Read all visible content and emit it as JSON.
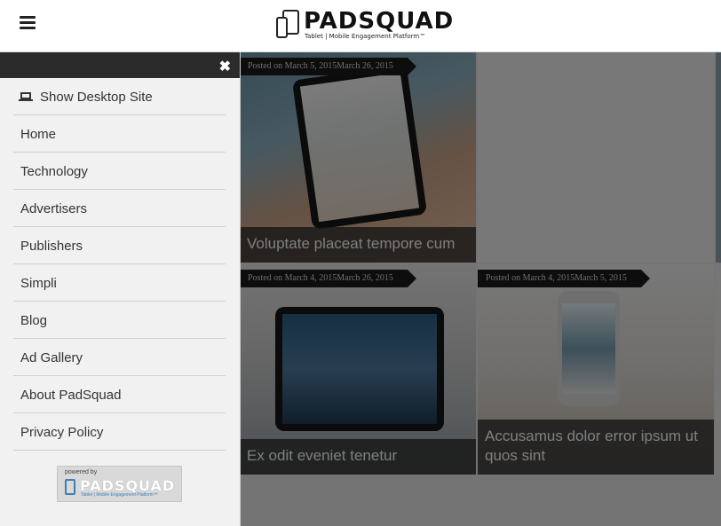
{
  "header": {
    "logo_word": "PADSQUAD",
    "logo_tagline": "Tablet | Mobile Engagement Platform™"
  },
  "sidebar": {
    "close_icon": "close-icon",
    "items": [
      {
        "label": "Show Desktop Site",
        "icon": "laptop-icon"
      },
      {
        "label": "Home"
      },
      {
        "label": "Technology"
      },
      {
        "label": "Advertisers"
      },
      {
        "label": "Publishers"
      },
      {
        "label": "Simpli"
      },
      {
        "label": "Blog"
      },
      {
        "label": "Ad Gallery"
      },
      {
        "label": "About PadSquad"
      },
      {
        "label": "Privacy Policy"
      }
    ],
    "powered": {
      "small": "powered by",
      "word": "PADSQUAD",
      "tagline": "Tablet | Mobile Engagement Platform™"
    }
  },
  "posts": [
    {
      "posted": "Posted on March 5, 2015March 26, 2015",
      "title": "Voluptate placeat tempore cum"
    },
    {
      "posted": "Posted on March 4, 2015March 26, 2015",
      "title": "Ex odit eveniet tenetur"
    },
    {
      "posted": "Posted on March 4, 2015March 5, 2015",
      "title": "Accusamus dolor error ipsum ut quos sint"
    }
  ]
}
